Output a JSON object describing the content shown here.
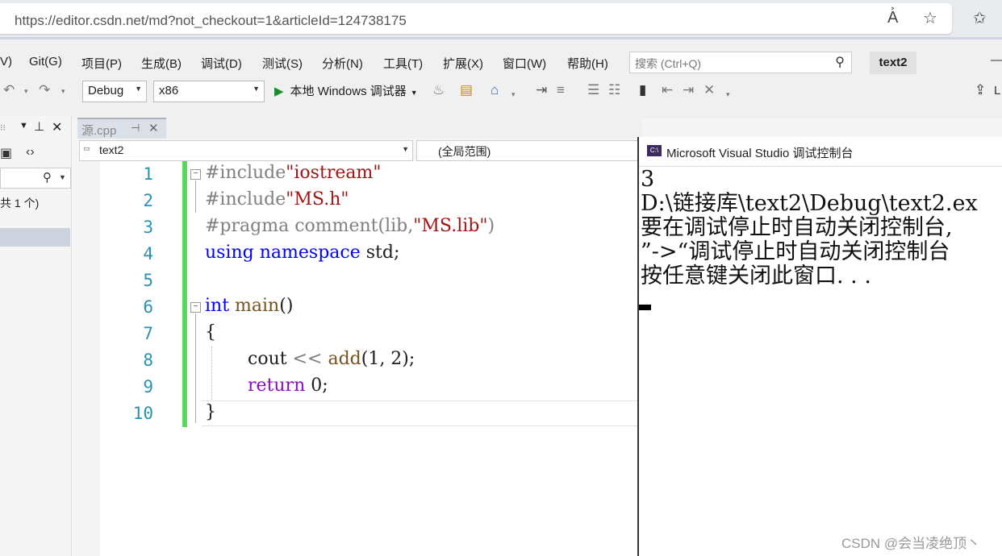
{
  "browser": {
    "url": "https://editor.csdn.net/md?not_checkout=1&articleId=124738175",
    "icons": [
      "read-aloud-icon",
      "add-favorite-icon",
      "favorites-icon"
    ]
  },
  "vs": {
    "menu": [
      "V)",
      "Git(G)",
      "项目(P)",
      "生成(B)",
      "调试(D)",
      "测试(S)",
      "分析(N)",
      "工具(T)",
      "扩展(X)",
      "窗口(W)",
      "帮助(H)"
    ],
    "search_placeholder": "搜索 (Ctrl+Q)",
    "solution_name": "text2",
    "minimize_glyph": "—",
    "config": "Debug",
    "platform": "x86",
    "run_label": "本地 Windows 调试器",
    "share_glyph": "L"
  },
  "left_panel": {
    "count_text": "共 1 个)"
  },
  "editor": {
    "tab_name": "源.cpp",
    "project_combo": "text2",
    "scope_combo": "(全局范围)",
    "line_numbers": [
      "1",
      "2",
      "3",
      "4",
      "5",
      "6",
      "7",
      "8",
      "9",
      "10"
    ],
    "lines": {
      "l1_pp": "#include",
      "l1_str": "\"iostream\"",
      "l2_pp": "#include",
      "l2_str": "\"MS.h\"",
      "l3_pp": "#pragma comment",
      "l3_a": "(lib,",
      "l3_str": "\"MS.lib\"",
      "l3_b": ")",
      "l4_kw1": "using",
      "l4_kw2": "namespace",
      "l4_rest": " std;",
      "l6_kw": "int",
      "l6_fn": "main",
      "l6_rest": "()",
      "l7": "{",
      "l8_a": "cout ",
      "l8_op": "<<",
      "l8_fn": " add",
      "l8_rest": "(1, 2);",
      "l9_kw": "return",
      "l9_rest": " 0;",
      "l10": "}"
    }
  },
  "console": {
    "title": "Microsoft Visual Studio 调试控制台",
    "lines": [
      "3",
      "D:\\链接库\\text2\\Debug\\text2.ex",
      "要在调试停止时自动关闭控制台,",
      "”->“调试停止时自动关闭控制台",
      "按任意键关闭此窗口. . ."
    ]
  },
  "watermark": "CSDN @会当凌绝顶丶"
}
